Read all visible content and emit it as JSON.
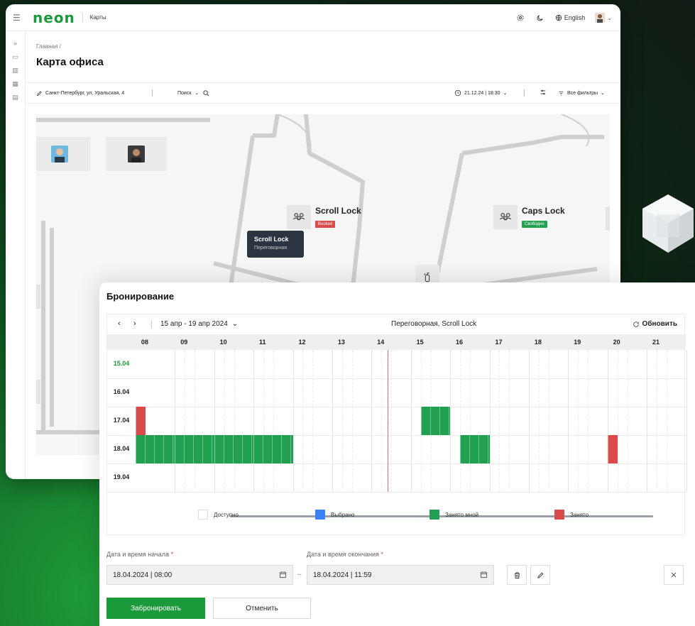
{
  "app": {
    "logo": "neon",
    "section": "Карты",
    "language": "English"
  },
  "page": {
    "breadcrumb": "Главная /",
    "title": "Карта офиса"
  },
  "filters": {
    "address": "Санкт-Петербург, ул. Уральская, 4",
    "search_label": "Поиск",
    "datetime": "21.12.24 | 18:30",
    "all_filters": "Все фильтры"
  },
  "map": {
    "rooms": [
      {
        "name": "Scroll Lock",
        "status": "Booked"
      },
      {
        "name": "Caps Lock",
        "status": "Свободно"
      }
    ],
    "tooltip": {
      "title": "Scroll Lock",
      "subtitle": "Переговорная"
    }
  },
  "booking": {
    "title": "Бронирование",
    "range": "15 апр - 19 апр 2024",
    "room": "Переговорная, Scroll Lock",
    "refresh": "Обновить",
    "hours": [
      "08",
      "09",
      "10",
      "11",
      "12",
      "13",
      "14",
      "15",
      "16",
      "17",
      "18",
      "19",
      "20",
      "21"
    ],
    "days": [
      {
        "label": "15.04",
        "today": true
      },
      {
        "label": "16.04",
        "today": false
      },
      {
        "label": "17.04",
        "today": false
      },
      {
        "label": "18.04",
        "today": false
      },
      {
        "label": "19.04",
        "today": false
      }
    ],
    "now_hour": 14.15,
    "blocks": [
      {
        "day": 2,
        "start": 7.75,
        "end": 8.0,
        "kind": "busy"
      },
      {
        "day": 2,
        "start": 15.0,
        "end": 15.75,
        "kind": "mine"
      },
      {
        "day": 3,
        "start": 7.75,
        "end": 8.75,
        "kind": "mine"
      },
      {
        "day": 3,
        "start": 8.75,
        "end": 9.75,
        "kind": "mine"
      },
      {
        "day": 3,
        "start": 9.75,
        "end": 10.75,
        "kind": "mine"
      },
      {
        "day": 3,
        "start": 10.75,
        "end": 11.75,
        "kind": "mine"
      },
      {
        "day": 3,
        "start": 16.0,
        "end": 16.75,
        "kind": "mine"
      },
      {
        "day": 3,
        "start": 19.75,
        "end": 20.0,
        "kind": "busy"
      }
    ],
    "legend": [
      {
        "label": "Доступно",
        "color": "#ffffff"
      },
      {
        "label": "Выбрано",
        "color": "#3b82f6"
      },
      {
        "label": "Занято мной",
        "color": "#22a052"
      },
      {
        "label": "Занято",
        "color": "#d94b4b"
      }
    ],
    "start_label": "Дата и время начала",
    "end_label": "Дата и время окончания",
    "required_mark": "*",
    "start_value": "18.04.2024 | 08:00",
    "end_value": "18.04.2024 | 11:59",
    "submit": "Забронировать",
    "cancel": "Отменить"
  },
  "colors": {
    "brand": "#1a9a3a",
    "busy": "#d94b4b",
    "mine": "#22a052"
  }
}
